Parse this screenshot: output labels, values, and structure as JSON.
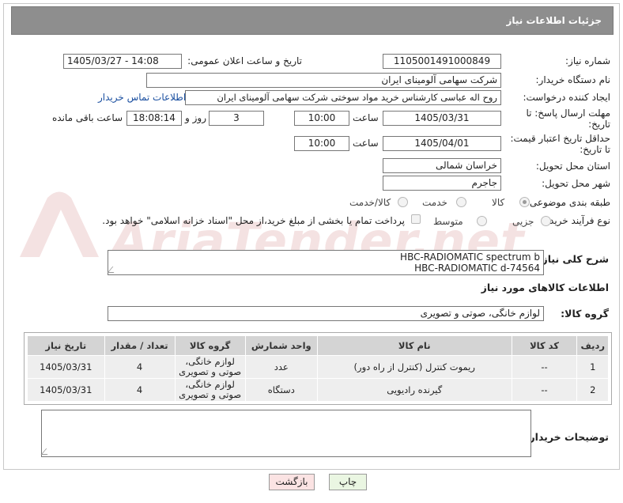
{
  "header": {
    "title": "جزئیات اطلاعات نیاز"
  },
  "fields": {
    "need_number": {
      "label": "شماره نیاز:",
      "value": "1105001491000849"
    },
    "announce_datetime": {
      "label": "تاریخ و ساعت اعلان عمومی:",
      "value": "1405/03/27 - 14:08"
    },
    "buyer_org": {
      "label": "نام دستگاه خریدار:",
      "value": "شرکت سهامی آلومینای ایران"
    },
    "requester": {
      "label": "ایجاد کننده درخواست:",
      "value": "روح اله عباسی کارشناس خرید مواد سوختی شرکت سهامی آلومینای ایران",
      "contact_link": "اطلاعات تماس خریدار"
    },
    "reply_deadline": {
      "label": "مهلت ارسال پاسخ: تا تاریخ:",
      "date": "1405/03/31",
      "time_label": "ساعت",
      "time": "10:00",
      "days": "3",
      "days_label": "روز و",
      "remaining_time": "18:08:14",
      "remaining_label": "ساعت باقی مانده"
    },
    "price_validity": {
      "label": "حداقل تاریخ اعتبار قیمت: تا تاریخ:",
      "date": "1405/04/01",
      "time_label": "ساعت",
      "time": "10:00"
    },
    "delivery_province": {
      "label": "استان محل تحویل:",
      "value": "خراسان شمالی"
    },
    "delivery_city": {
      "label": "شهر محل تحویل:",
      "value": "جاجرم"
    },
    "category": {
      "label": "طبقه بندی موضوعی:",
      "options": [
        "کالا",
        "خدمت",
        "کالا/خدمت"
      ]
    },
    "purchase_type": {
      "label": "نوع فرآیند خرید :",
      "options": [
        "جزیی",
        "متوسط"
      ],
      "payment_note": "پرداخت تمام یا بخشی از مبلغ خرید،از محل \"اسناد خزانه اسلامی\" خواهد بود."
    }
  },
  "description": {
    "label": "شرح کلی نیاز:",
    "line1": "HBC-RADIOMATIC spectrum b",
    "line2": "HBC-RADIOMATIC d-74564"
  },
  "goods_info_title": "اطلاعات کالاهای مورد نیاز",
  "goods_group": {
    "label": "گروه کالا:",
    "value": "لوازم خانگی، صوتی و تصویری"
  },
  "table": {
    "headers": [
      "ردیف",
      "کد کالا",
      "نام کالا",
      "واحد شمارش",
      "گروه کالا",
      "تعداد / مقدار",
      "تاریخ نیاز"
    ],
    "rows": [
      {
        "row": "1",
        "code": "--",
        "name": "ریموت کنترل (کنترل از راه دور)",
        "unit": "عدد",
        "group": "لوازم خانگی، صوتی و تصویری",
        "qty": "4",
        "date": "1405/03/31"
      },
      {
        "row": "2",
        "code": "--",
        "name": "گیرنده رادیویی",
        "unit": "دستگاه",
        "group": "لوازم خانگی، صوتی و تصویری",
        "qty": "4",
        "date": "1405/03/31"
      }
    ]
  },
  "buyer_notes": {
    "label": "توضیحات خریدار:"
  },
  "buttons": {
    "print": "چاپ",
    "back": "بازگشت"
  },
  "watermark": "AriaTender.net",
  "colors": {
    "header": "#8e8e8e",
    "link": "#1a4fa0",
    "print_btn": "#eaf6e2",
    "back_btn": "#fbe3e3",
    "watermark": "#b0262a"
  }
}
